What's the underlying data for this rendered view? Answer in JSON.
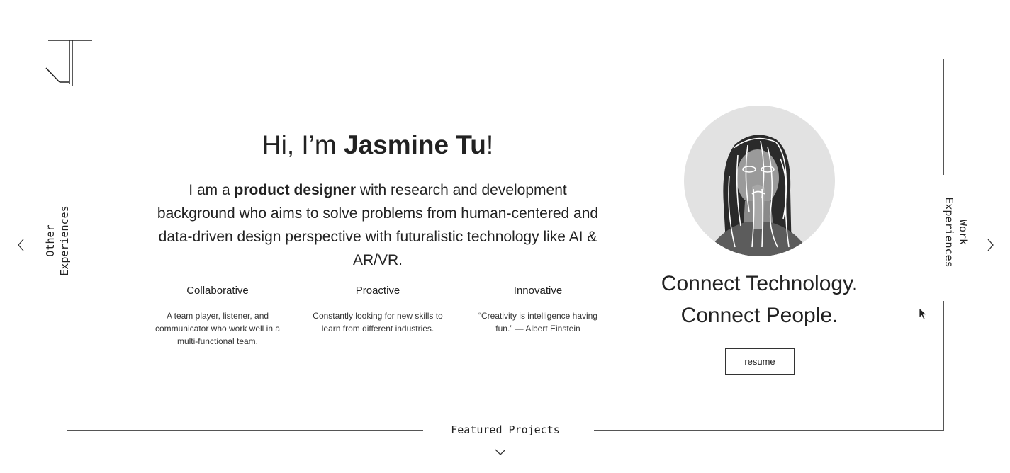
{
  "logo": {
    "name": "JT monogram"
  },
  "nav": {
    "left_label_line1": "Other",
    "left_label_line2": "Experiences",
    "right_label_line1": "Work",
    "right_label_line2": "Experiences"
  },
  "hero": {
    "greeting_prefix": "Hi, I’m ",
    "name": "Jasmine Tu",
    "greeting_suffix": "!",
    "intro_prefix": "I am a ",
    "intro_bold": "product designer",
    "intro_rest": " with research and development background who aims to solve problems from human-centered and data-driven design perspective with futuralistic technology like AI & AR/VR."
  },
  "traits": [
    {
      "title": "Collaborative",
      "desc": "A team player, listener, and communicator who work well in a multi-functional team."
    },
    {
      "title": "Proactive",
      "desc": "Constantly looking for new skills to learn from different industries."
    },
    {
      "title": "Innovative",
      "desc": "“Creativity is intelligence having fun.” — Albert Einstein"
    }
  ],
  "tagline": {
    "line1": "Connect Technology.",
    "line2": "Connect People."
  },
  "resume_label": "resume",
  "featured_label": "Featured Projects",
  "icons": {
    "left_arrow": "chevron-left-icon",
    "right_arrow": "chevron-right-icon",
    "down_arrow": "chevron-down-icon",
    "cursor": "mouse-pointer-icon"
  },
  "colors": {
    "text": "#222222",
    "line": "#555555",
    "background": "#ffffff"
  }
}
